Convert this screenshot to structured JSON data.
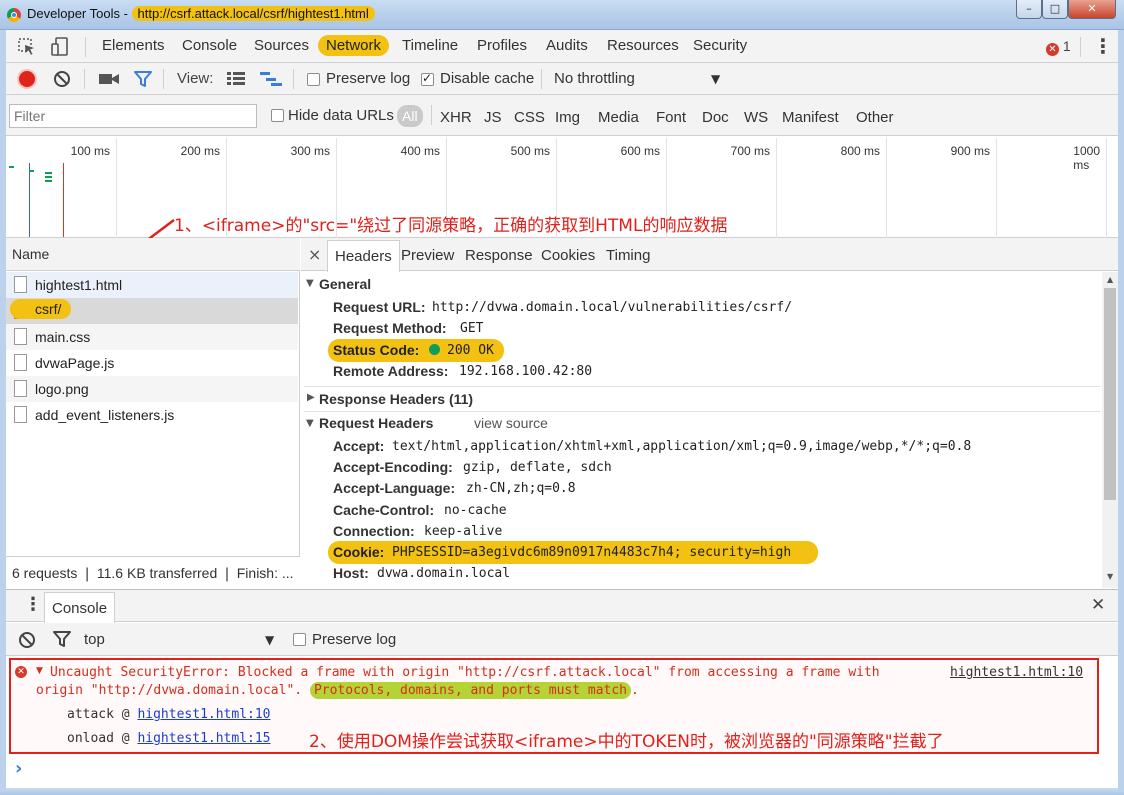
{
  "window": {
    "title_prefix": "Developer Tools - ",
    "title_url": "http://csrf.attack.local/csrf/hightest1.html",
    "btn_min": "–",
    "btn_max": "□",
    "btn_close": "✕"
  },
  "main_tabs": {
    "elements": "Elements",
    "console": "Console",
    "sources": "Sources",
    "network": "Network",
    "timeline": "Timeline",
    "profiles": "Profiles",
    "audits": "Audits",
    "resources": "Resources",
    "security": "Security",
    "error_count": "1",
    "more": "⋮"
  },
  "network_toolbar": {
    "view_label": "View:",
    "preserve_log": "Preserve log",
    "disable_cache": "Disable cache",
    "disable_cache_checked": true,
    "throttling": "No throttling",
    "dropdown": "▼"
  },
  "filter_bar": {
    "placeholder": "Filter",
    "hide_data_urls": "Hide data URLs",
    "types": [
      "All",
      "XHR",
      "JS",
      "CSS",
      "Img",
      "Media",
      "Font",
      "Doc",
      "WS",
      "Manifest",
      "Other"
    ]
  },
  "timeline_ticks": [
    "100 ms",
    "200 ms",
    "300 ms",
    "400 ms",
    "500 ms",
    "600 ms",
    "700 ms",
    "800 ms",
    "900 ms",
    "1000 ms"
  ],
  "annotation1": "1、<iframe>的\"src=\"绕过了同源策略，正确的获取到HTML的响应数据",
  "request_list": {
    "header": "Name",
    "items": [
      "hightest1.html",
      "csrf/",
      "main.css",
      "dvwaPage.js",
      "logo.png",
      "add_event_listeners.js"
    ],
    "summary": "6 requests ❘ 11.6 KB transferred ❘ Finish: ..."
  },
  "detail_tabs": {
    "close": "×",
    "headers": "Headers",
    "preview": "Preview",
    "response": "Response",
    "cookies": "Cookies",
    "timing": "Timing"
  },
  "general": {
    "title": "General",
    "request_url_key": "Request URL:",
    "request_url": "http://dvwa.domain.local/vulnerabilities/csrf/",
    "request_method_key": "Request Method:",
    "request_method": "GET",
    "status_code_key": "Status Code:",
    "status_code": "200 OK",
    "remote_address_key": "Remote Address:",
    "remote_address": "192.168.100.42:80"
  },
  "response_headers": {
    "title": "Response Headers (11)"
  },
  "request_headers": {
    "title": "Request Headers",
    "view_source": "view source",
    "accept_key": "Accept:",
    "accept": "text/html,application/xhtml+xml,application/xml;q=0.9,image/webp,*/*;q=0.8",
    "accept_encoding_key": "Accept-Encoding:",
    "accept_encoding": "gzip, deflate, sdch",
    "accept_language_key": "Accept-Language:",
    "accept_language": "zh-CN,zh;q=0.8",
    "cache_control_key": "Cache-Control:",
    "cache_control": "no-cache",
    "connection_key": "Connection:",
    "connection": "keep-alive",
    "cookie_key": "Cookie:",
    "cookie": "PHPSESSID=a3egivdc6m89n0917n4483c7h4; security=high",
    "host_key": "Host:",
    "host": "dvwa.domain.local"
  },
  "console_drawer": {
    "tab": "Console",
    "close": "✕",
    "context": "top",
    "preserve_log": "Preserve log",
    "error_line1": "Uncaught SecurityError: Blocked a frame with origin \"http://csrf.attack.local\" from accessing a frame with",
    "error_line2a": "origin \"http://dvwa.domain.local\".",
    "error_line2b": "Protocols, domains, and ports must match",
    "error_line2c": ".",
    "error_source": "hightest1.html:10",
    "stack1_fn": "attack @",
    "stack1_link": "hightest1.html:10",
    "stack2_fn": "onload @",
    "stack2_link": "hightest1.html:15",
    "prompt": "›"
  },
  "annotation2": "2、使用DOM操作尝试获取<iframe>中的TOKEN时，被浏览器的\"同源策略\"拦截了",
  "colors": {
    "highlight": "#f3c112",
    "error": "#d32f1e",
    "accent": "#3b7ddd",
    "annotation": "#e0201a"
  }
}
